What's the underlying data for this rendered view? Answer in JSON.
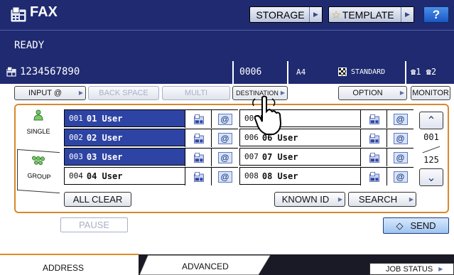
{
  "title": "FAX",
  "status": "READY",
  "top_buttons": {
    "storage": "STORAGE",
    "template": "TEMPLATE",
    "help": "?"
  },
  "info": {
    "fax_number": "1234567890",
    "count": "0006",
    "paper": "A4",
    "quality": "STANDARD",
    "lines": "☎1 ☎2"
  },
  "toolbar": {
    "input": "INPUT @",
    "backspace": "BACK SPACE",
    "multi": "MULTI",
    "destination": "DESTINATION",
    "option": "OPTION",
    "monitor": "MONITOR"
  },
  "side_tabs": {
    "single": "SINGLE",
    "group": "GROUP"
  },
  "entries_left": [
    {
      "num": "001",
      "name": "01 User",
      "selected": true
    },
    {
      "num": "002",
      "name": "02 User",
      "selected": true
    },
    {
      "num": "003",
      "name": "03 User",
      "selected": true
    },
    {
      "num": "004",
      "name": "04 User",
      "selected": false
    }
  ],
  "entries_right": [
    {
      "num": "00",
      "name": "User"
    },
    {
      "num": "006",
      "name": "06 User"
    },
    {
      "num": "007",
      "name": "07 User"
    },
    {
      "num": "008",
      "name": "08 User"
    }
  ],
  "paging": {
    "current": "001",
    "total": "125"
  },
  "bottom": {
    "all_clear": "ALL CLEAR",
    "known_id": "KNOWN ID",
    "search": "SEARCH",
    "pause": "PAUSE",
    "send": "SEND"
  },
  "tabs": {
    "address": "ADDRESS",
    "advanced": "ADVANCED"
  },
  "job_status": "JOB STATUS",
  "colors": {
    "dark_blue": "#1f2a70",
    "selected_blue": "#2e44a4",
    "orange": "#d7892b"
  }
}
